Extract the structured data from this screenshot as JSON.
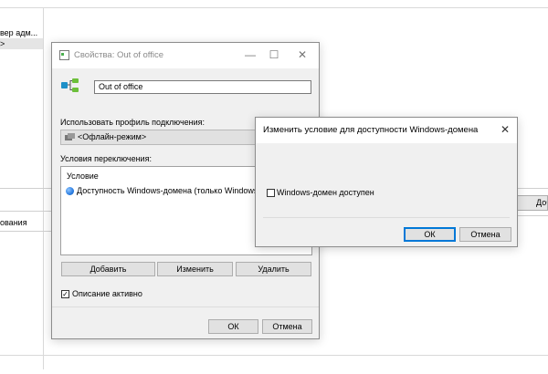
{
  "background": {
    "sidebar_items": [
      "вер адм...",
      ">"
    ],
    "bottom_label": "ования",
    "right_button": "Доб"
  },
  "props_dialog": {
    "title": "Свойства: Out of office",
    "controls": {
      "minimize": "—",
      "maximize": "☐",
      "close": "✕"
    },
    "name_value": "Out of office",
    "profile_label": "Использовать профиль подключения:",
    "profile_value": "<Офлайн-режим>",
    "conditions_label": "Условия переключения:",
    "conditions_header": "Условие",
    "conditions_items": [
      "Доступность Windows-домена (только Windows)"
    ],
    "add_button": "Добавить",
    "edit_button": "Изменить",
    "delete_button": "Удалить",
    "active_checkbox_label": "Описание активно",
    "active_checked": true,
    "ok_button": "ОК",
    "cancel_button": "Отмена"
  },
  "condition_dialog": {
    "title": "Изменить условие для доступности Windows-домена",
    "close": "✕",
    "checkbox_label": "Windows-домен доступен",
    "checked": false,
    "ok_button": "ОК",
    "cancel_button": "Отмена"
  },
  "colors": {
    "accent": "#0078d7",
    "dialog_bg": "#f0f0f0",
    "globe_icon": "#2b7de1",
    "profile_icon": "#1e90c8"
  }
}
